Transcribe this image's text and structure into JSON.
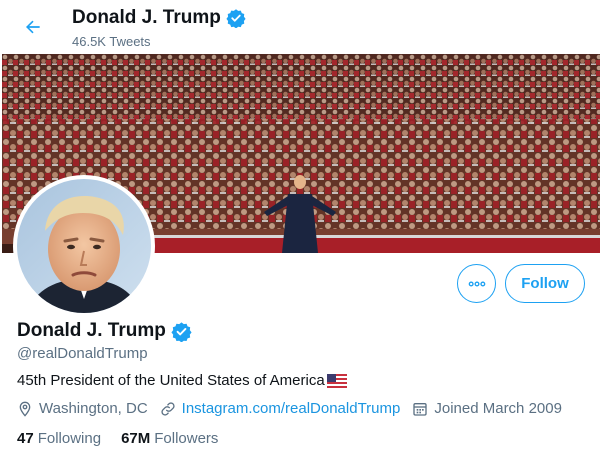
{
  "header": {
    "title": "Donald J. Trump",
    "tweet_count": "46.5K Tweets"
  },
  "profile": {
    "name": "Donald J. Trump",
    "handle": "@realDonaldTrump",
    "bio": "45th President of the United States of America",
    "bio_emoji": "us-flag",
    "location": "Washington, DC",
    "link": "Instagram.com/realDonaldTrump",
    "joined": "Joined March 2009",
    "verified": true
  },
  "actions": {
    "follow_label": "Follow",
    "more_icon": "ellipsis-icon"
  },
  "stats": {
    "following_count": "47",
    "following_label": "Following",
    "followers_count": "67M",
    "followers_label": "Followers"
  },
  "colors": {
    "accent": "#1da1f2",
    "link": "#1b95e0",
    "muted": "#5b7083",
    "text": "#0f1419"
  }
}
